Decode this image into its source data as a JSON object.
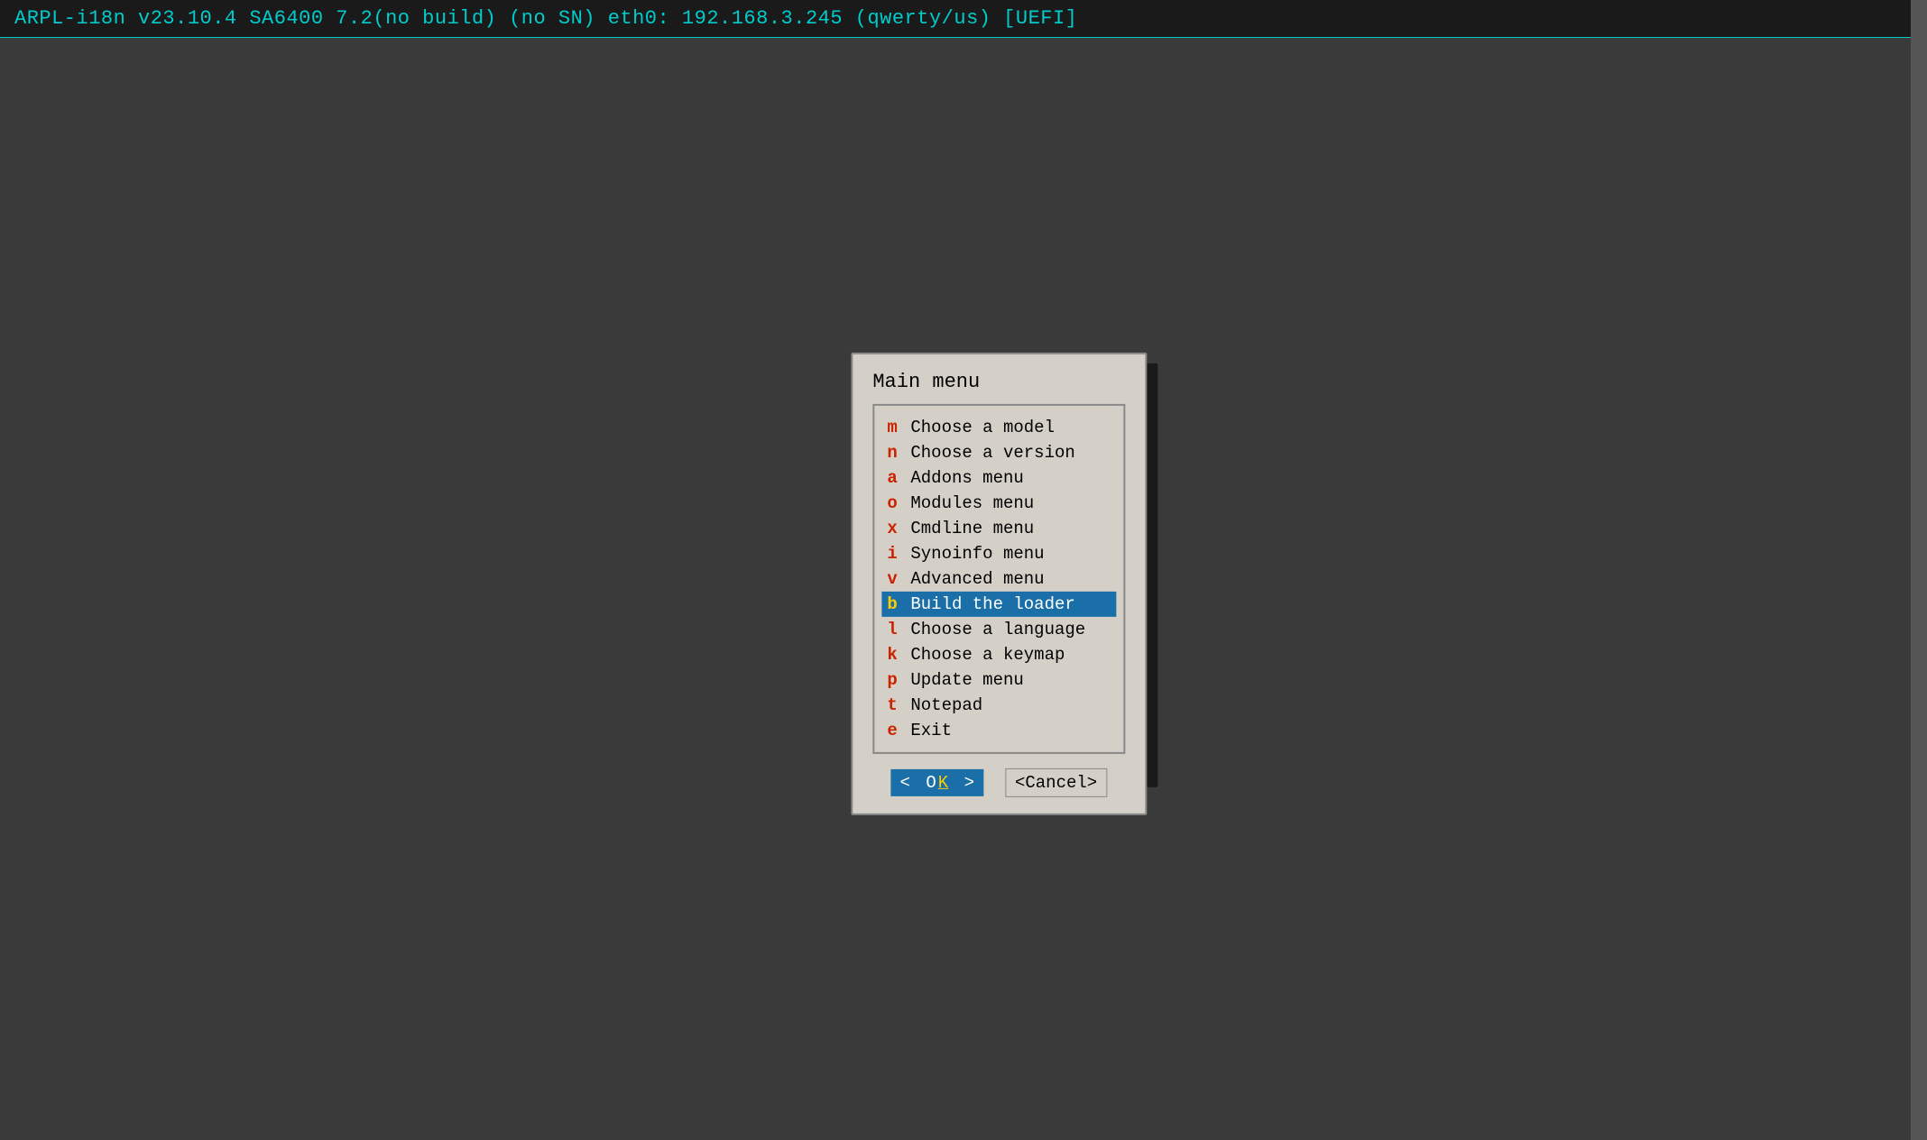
{
  "statusbar": {
    "text": "ARPL-i18n v23.10.4 SA6400 7.2(no build) (no SN) eth0: 192.168.3.245 (qwerty/us) [UEFI]"
  },
  "dialog": {
    "title": "Main menu",
    "menu_items": [
      {
        "key": "m",
        "label": "Choose a model",
        "selected": false
      },
      {
        "key": "n",
        "label": "Choose a version",
        "selected": false
      },
      {
        "key": "a",
        "label": "Addons menu",
        "selected": false
      },
      {
        "key": "o",
        "label": "Modules menu",
        "selected": false
      },
      {
        "key": "x",
        "label": "Cmdline menu",
        "selected": false
      },
      {
        "key": "i",
        "label": "Synoinfo menu",
        "selected": false
      },
      {
        "key": "v",
        "label": "Advanced menu",
        "selected": false
      },
      {
        "key": "b",
        "label": "Build the loader",
        "selected": true
      },
      {
        "key": "l",
        "label": "Choose a language",
        "selected": false
      },
      {
        "key": "k",
        "label": "Choose a keymap",
        "selected": false
      },
      {
        "key": "p",
        "label": "Update menu",
        "selected": false
      },
      {
        "key": "t",
        "label": "Notepad",
        "selected": false
      },
      {
        "key": "e",
        "label": "Exit",
        "selected": false
      }
    ],
    "btn_ok": "< OK >",
    "btn_cancel": "<Cancel>"
  }
}
